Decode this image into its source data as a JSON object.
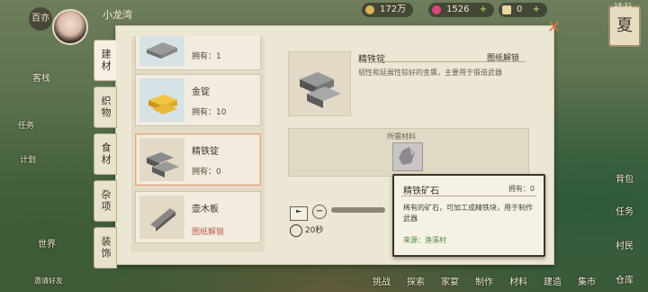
{
  "hud": {
    "season_char": "百亦",
    "player_name": "小龙湾",
    "currency1": "172万",
    "currency2": "1526",
    "currency3": "0",
    "season_badge": "夏",
    "clock": "18:31"
  },
  "left_side": {
    "items": [
      "客栈",
      "任务",
      "计划",
      "世界",
      "邀请好友"
    ]
  },
  "right_side": {
    "items": [
      "背包",
      "任务",
      "村民",
      "仓库"
    ]
  },
  "tabs": [
    "建材",
    "织物",
    "食材",
    "杂项",
    "装饰"
  ],
  "list_items": [
    {
      "name": "",
      "owned": "拥有：1",
      "tag": ""
    },
    {
      "name": "金锭",
      "owned": "拥有：10",
      "tag": ""
    },
    {
      "name": "精铁锭",
      "owned": "拥有：0",
      "tag": ""
    },
    {
      "name": "壶木板",
      "owned": "",
      "tag": "图纸解锁"
    }
  ],
  "detail": {
    "name": "精铁锭",
    "unlock": "图纸解锁",
    "desc": "韧性和延展性较好的金属，主要用于锻造武器",
    "materials_title": "所需材料",
    "time": "20秒"
  },
  "tooltip": {
    "title": "精铁矿石",
    "owned": "拥有：0",
    "desc": "稀有的矿石，可加工成精铁块，用于制作武器",
    "source": "来源：渔溪村"
  },
  "bottom": [
    "挑战",
    "探索",
    "家宴",
    "制作",
    "材料",
    "建造",
    "集市"
  ]
}
